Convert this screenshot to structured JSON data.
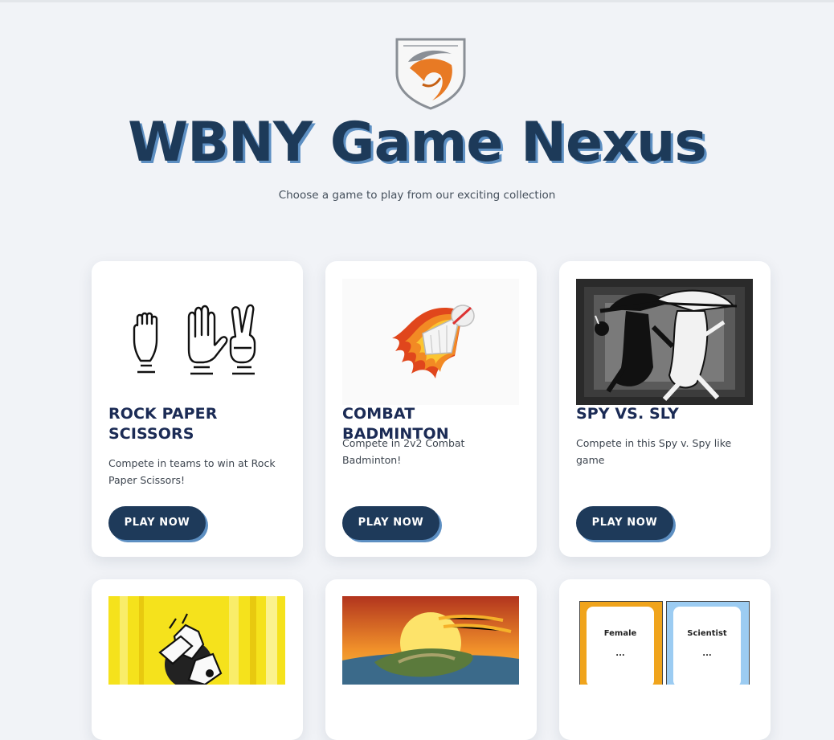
{
  "header": {
    "title": "WBNY Game Nexus",
    "subtitle": "Choose a game to play from our exciting collection",
    "logo": "shield-dragon-logo",
    "colors": {
      "background": "#f1f3f7",
      "title": "#1d3a59",
      "title_shadow": "#5d8fc2",
      "shield_orange": "#e87a24",
      "shield_gray": "#8a8f96"
    }
  },
  "games": [
    {
      "title": "ROCK PAPER SCISSORS",
      "description": "Compete in teams to win at Rock Paper Scissors!",
      "button_label": "PLAY NOW",
      "icon": "rock-paper-scissors-hands"
    },
    {
      "title": "COMBAT BADMINTON",
      "description": "Compete in 2v2 Combat Badminton!",
      "button_label": "PLAY NOW",
      "icon": "flaming-shuttlecock"
    },
    {
      "title": "SPY VS. SLY",
      "description": "Compete in this Spy v. Spy like game",
      "button_label": "PLAY NOW",
      "icon": "spy-vs-spy-illustration"
    },
    {
      "icon": "yellow-cartoon-art"
    },
    {
      "icon": "sunset-island"
    },
    {
      "icon": "identity-cards",
      "card_labels": [
        "Female",
        "Scientist"
      ],
      "card_placeholder": "..."
    }
  ],
  "button_colors": {
    "background": "#1e3a5a",
    "shadow": "#5d8fc2",
    "text": "#ffffff"
  }
}
